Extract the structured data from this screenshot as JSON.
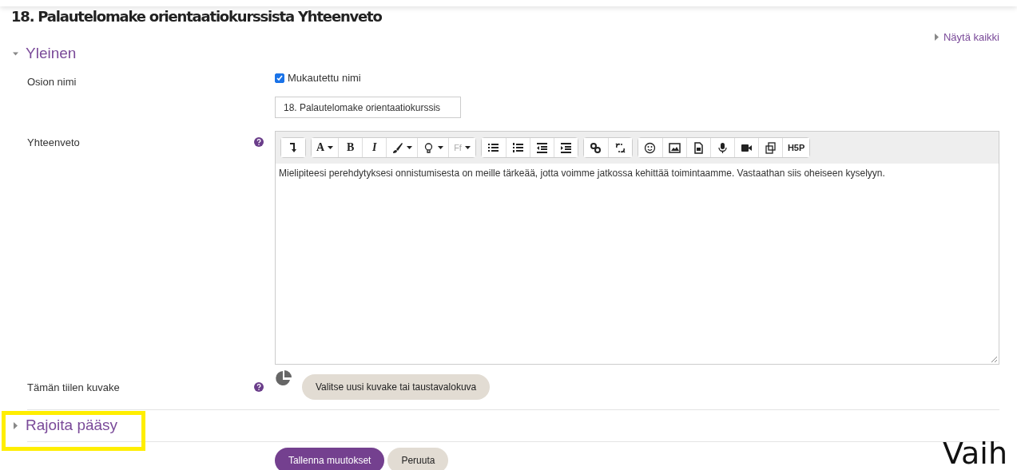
{
  "title": "18. Palautelomake orientaatiokurssista Yhteenveto",
  "show_all": "Näytä kaikki",
  "general": {
    "heading": "Yleinen",
    "expanded": true
  },
  "section_name": {
    "label": "Osion nimi",
    "custom_checked": true,
    "custom_label": "Mukautettu nimi",
    "value": "18. Palautelomake orientaatiokurssis"
  },
  "summary": {
    "label": "Yhteenveto",
    "toolbar": [
      [
        {
          "kind": "icon"
        }
      ],
      [
        {
          "kind": "dropdown",
          "label": "A"
        },
        {
          "kind": "text",
          "label": "B"
        },
        {
          "kind": "italic",
          "label": "I"
        },
        {
          "kind": "icondrop"
        },
        {
          "kind": "icondrop"
        },
        {
          "kind": "greydrop",
          "label": "Ff"
        }
      ],
      [
        {
          "kind": "icon"
        },
        {
          "kind": "icon"
        },
        {
          "kind": "icon"
        },
        {
          "kind": "icon"
        }
      ],
      [
        {
          "kind": "icon"
        },
        {
          "kind": "icon"
        }
      ],
      [
        {
          "kind": "icon"
        },
        {
          "kind": "icon"
        },
        {
          "kind": "icon"
        },
        {
          "kind": "icon"
        },
        {
          "kind": "icon"
        },
        {
          "kind": "icon"
        },
        {
          "kind": "text",
          "label": "H5P"
        }
      ]
    ],
    "text": "Mielipiteesi perehdytyksesi onnistumisesta on meille tärkeää, jotta voimme jatkossa kehittää toimintaamme. Vastaathan siis oheiseen kyselyyn."
  },
  "tile_icon": {
    "label": "Tämän tiilen kuvake",
    "button": "Valitse uusi kuvake tai taustavalokuva"
  },
  "restrict": {
    "heading": "Rajoita pääsy",
    "expanded": false,
    "highlighted": true
  },
  "buttons": [
    {
      "label": "Tallenna muutokset",
      "kind": "primary"
    },
    {
      "label": "Peruuta",
      "kind": "secondary"
    }
  ],
  "overlay_text": "Vaih"
}
